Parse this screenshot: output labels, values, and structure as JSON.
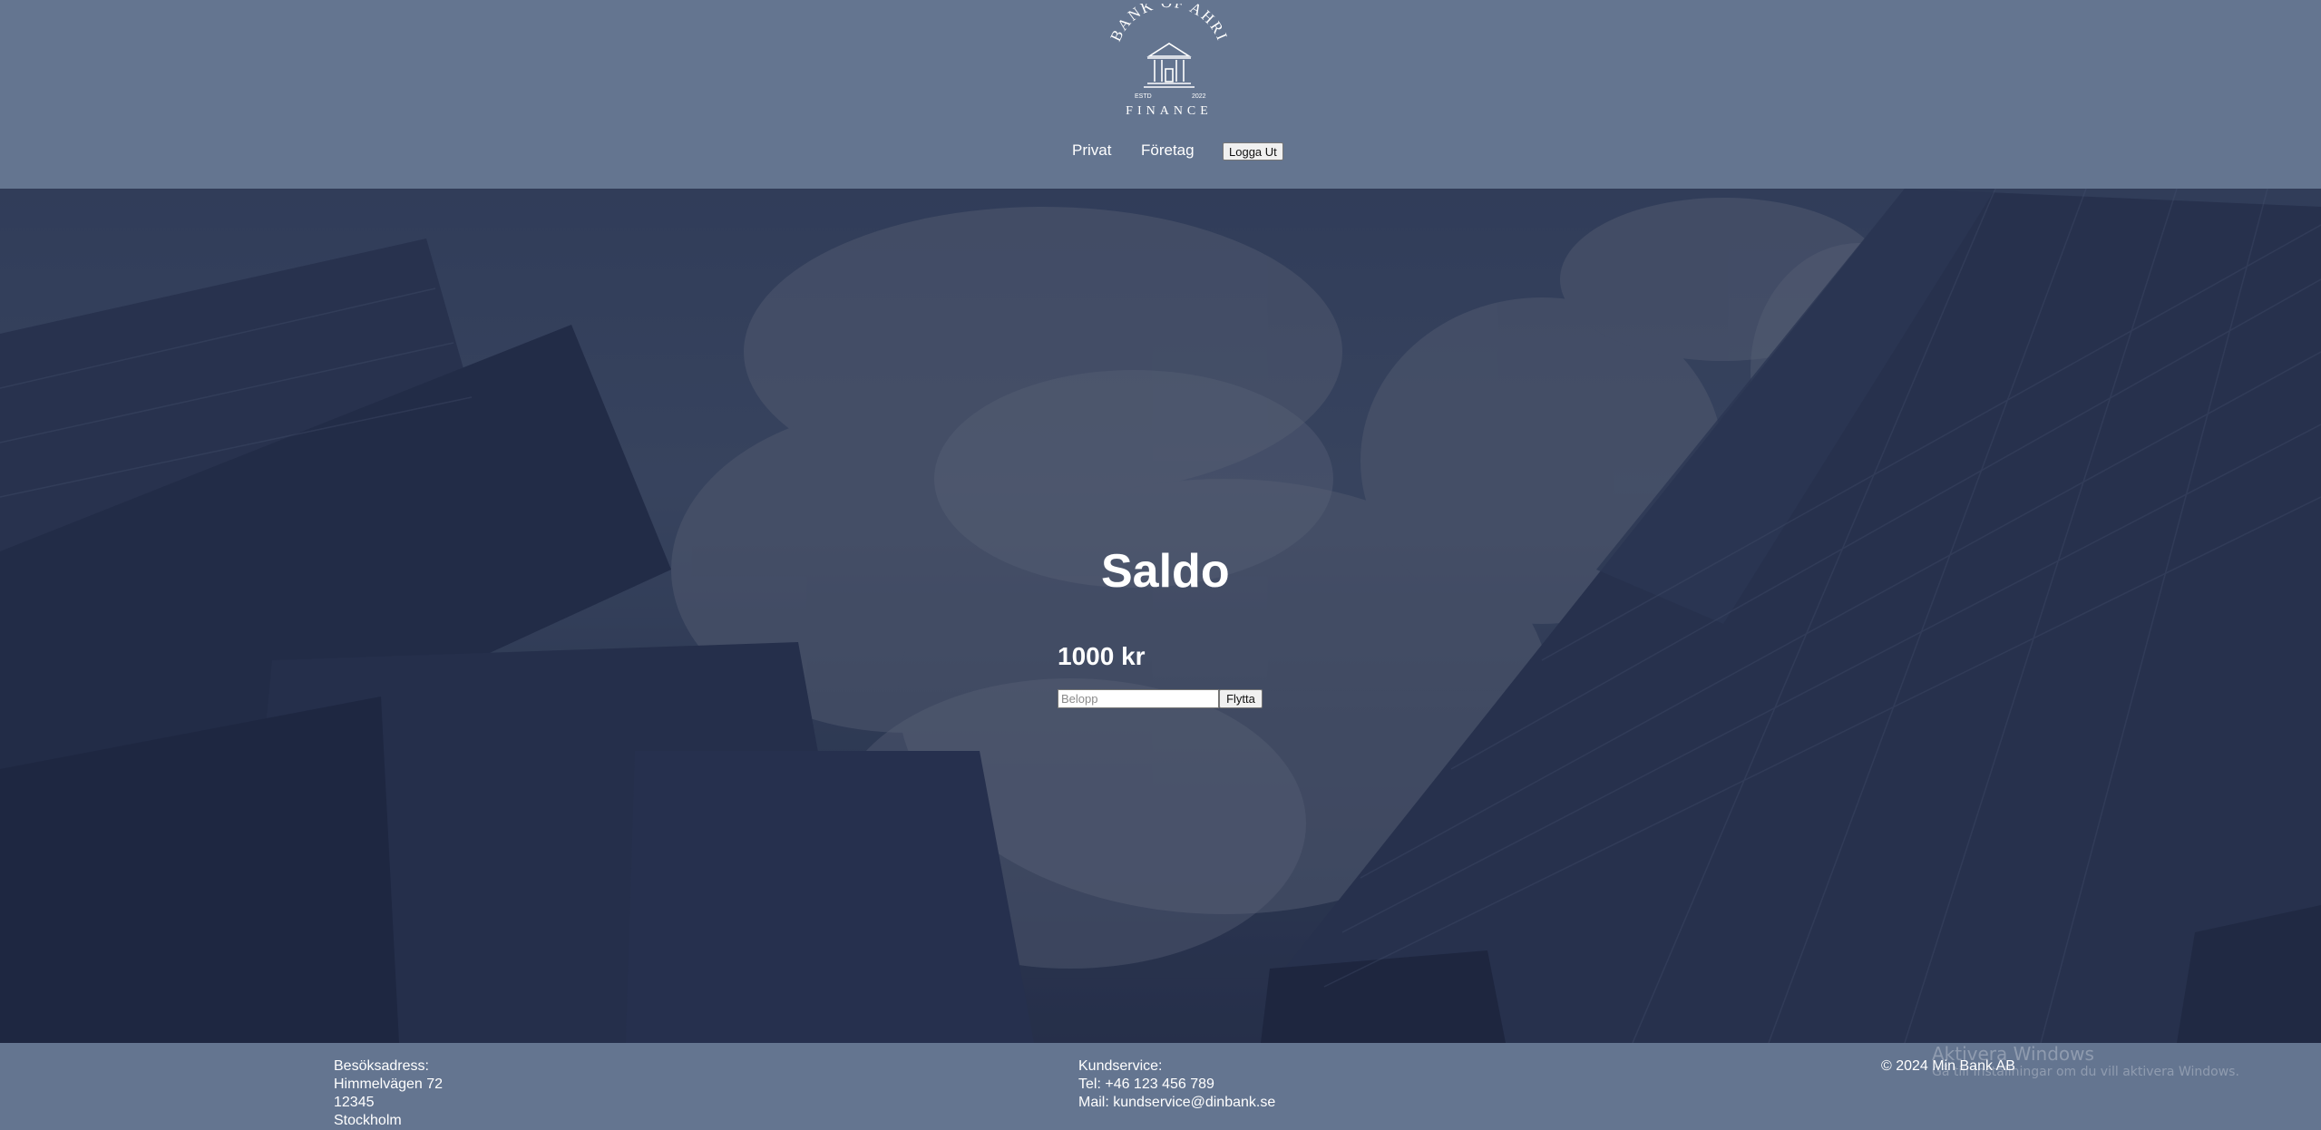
{
  "header": {
    "logo": {
      "top_text": "BANK OF AHRI",
      "bottom_text": "FINANCE",
      "estd": "ESTD",
      "year": "2022",
      "icon": "bank-building-icon"
    },
    "nav": {
      "privat": "Privat",
      "foretag": "Företag",
      "logout": "Logga Ut"
    }
  },
  "main": {
    "title": "Saldo",
    "balance": "1000 kr",
    "amount_placeholder": "Belopp",
    "move_button": "Flytta"
  },
  "footer": {
    "address": {
      "label": "Besöksadress:",
      "street": "Himmelvägen 72",
      "postal": "12345",
      "city": "Stockholm"
    },
    "service": {
      "label": "Kundservice:",
      "phone": "Tel: +46 123 456 789",
      "mail": "Mail: kundservice@dinbank.se"
    },
    "copyright": "© 2024 Min Bank AB"
  },
  "watermark": {
    "title": "Aktivera Windows",
    "subtitle": "Gå till Inställningar om du vill aktivera Windows."
  },
  "colors": {
    "header_bg": "#647590",
    "hero_overlay": "#3c4a68",
    "text": "#ffffff"
  }
}
